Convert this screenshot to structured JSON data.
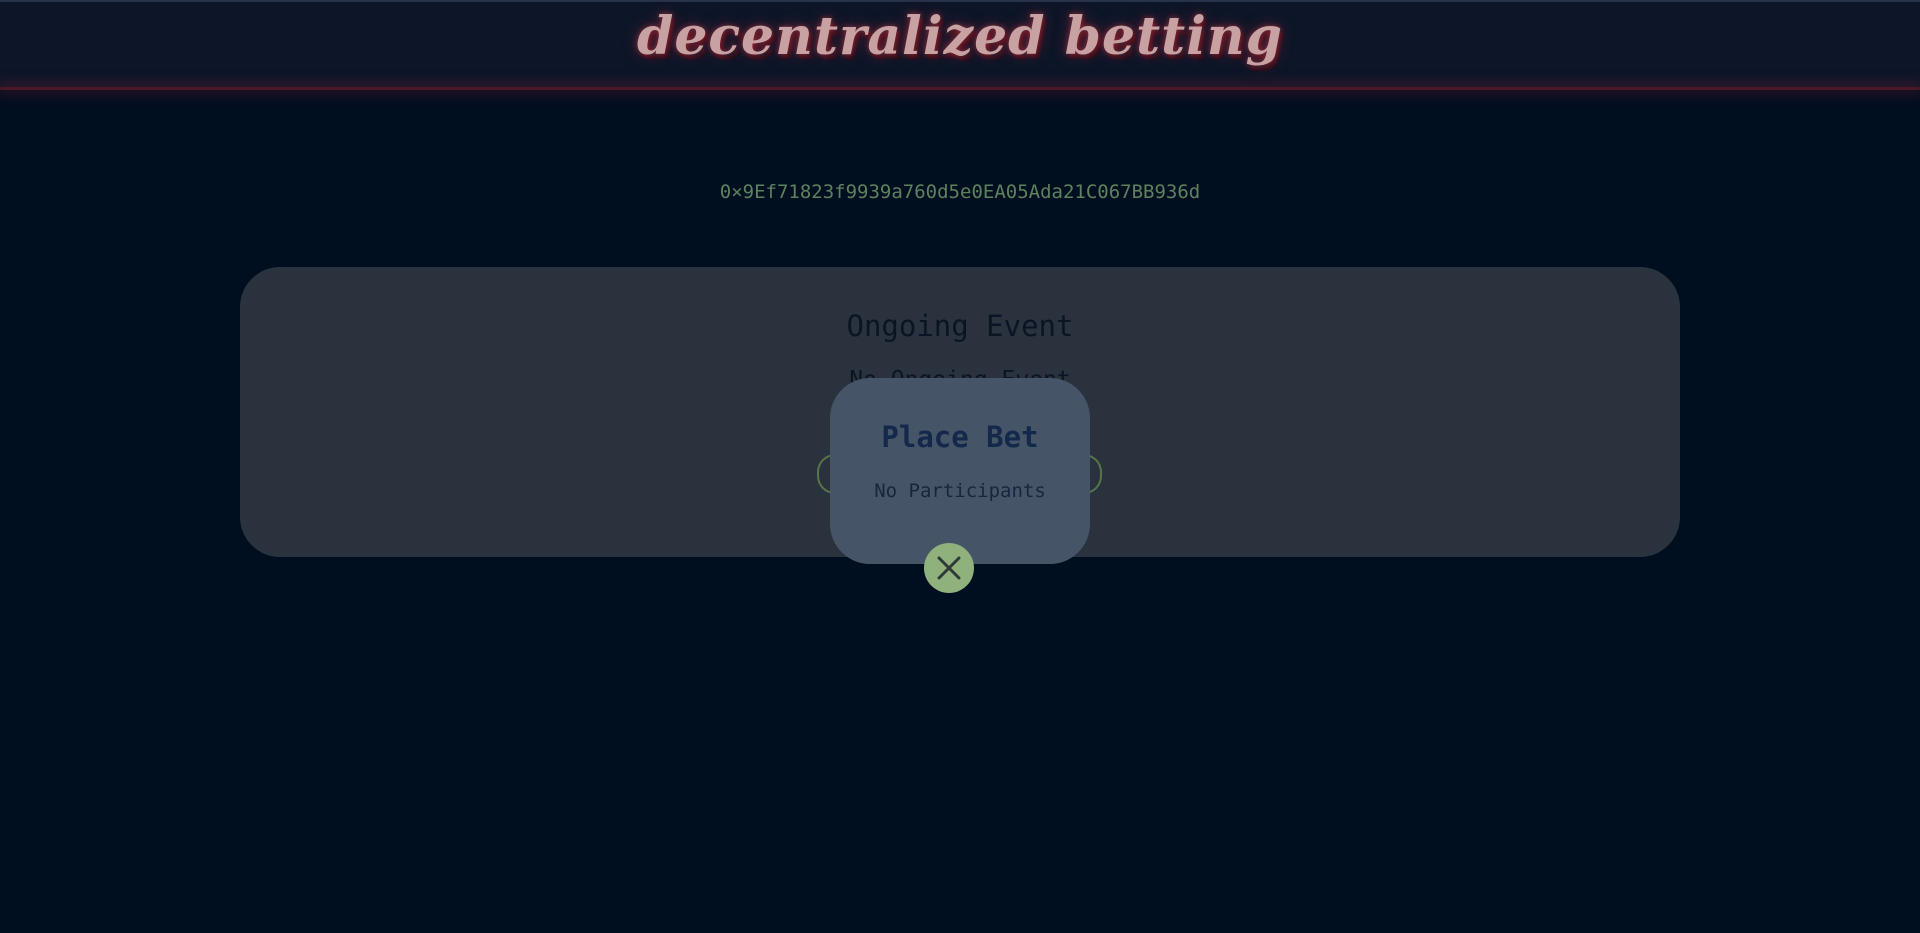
{
  "header": {
    "brand": "decentralized betting"
  },
  "wallet": {
    "address": "0×9Ef71823f9939a760d5e0EA05Ada21C067BB936d"
  },
  "event_card": {
    "title": "Ongoing Event",
    "status": "No Ongoing Event"
  },
  "modal": {
    "title": "Place Bet",
    "text": "No Participants",
    "close_icon": "close-icon"
  },
  "colors": {
    "background": "#000f20",
    "brand_glow": "#c8a2a2",
    "accent_green": "#8fb17c",
    "wallet_text": "#5d805d"
  }
}
